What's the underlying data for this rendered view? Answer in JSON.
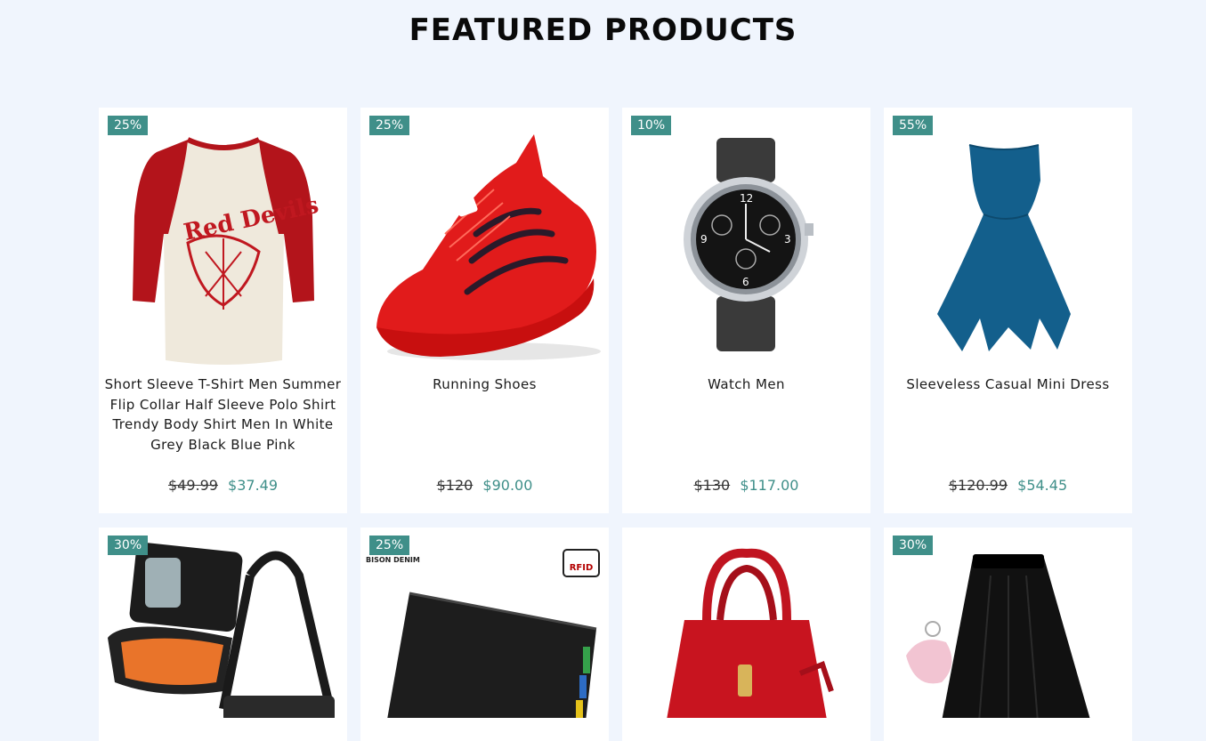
{
  "page": {
    "heading": "FEATURED PRODUCTS"
  },
  "products": [
    {
      "discount": "25%",
      "name": "Short Sleeve T-Shirt Men Summer Flip Collar Half Sleeve Polo Shirt Trendy Body Shirt Men In White Grey Black Blue Pink",
      "old_price": "$49.99",
      "new_price": "$37.49",
      "icon": "raglan-tshirt-image"
    },
    {
      "discount": "25%",
      "name": "Running Shoes",
      "old_price": "$120",
      "new_price": "$90.00",
      "icon": "red-running-shoe-image"
    },
    {
      "discount": "10%",
      "name": "Watch Men",
      "old_price": "$130",
      "new_price": "$117.00",
      "icon": "wristwatch-image"
    },
    {
      "discount": "55%",
      "name": "Sleeveless Casual Mini Dress",
      "old_price": "$120.99",
      "new_price": "$54.45",
      "icon": "blue-dress-image"
    },
    {
      "discount": "30%",
      "icon": "travel-organizer-bag-image"
    },
    {
      "discount": "25%",
      "icon": "black-wallet-image",
      "brand": "BISON DENIM",
      "rfid_label": "RFID"
    },
    {
      "discount": "",
      "icon": "red-handbag-image"
    },
    {
      "discount": "30%",
      "icon": "black-skirt-image"
    }
  ],
  "colors": {
    "accent": "#3f8f89",
    "background": "#f0f5fd"
  }
}
